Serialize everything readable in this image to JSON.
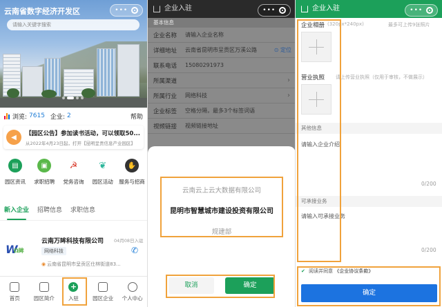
{
  "home": {
    "title": "云南省数字经济开发区",
    "search_placeholder": "请输入关键字搜索",
    "stats": {
      "views_label": "浏览:",
      "views": "7615",
      "companies_label": "企业:",
      "companies": "2",
      "help": "帮助"
    },
    "notice": {
      "title": "【园区公告】参加读书活动，可以领取50...",
      "sub": "从2022年4月23日起，打开【昆明呈贡信息产业园区】"
    },
    "services": [
      {
        "label": "园区资讯",
        "icon": "news-icon",
        "color": "#1ca05a"
      },
      {
        "label": "求职招聘",
        "icon": "briefcase-icon",
        "color": "#5ab84a"
      },
      {
        "label": "党务咨询",
        "icon": "party-emblem-icon",
        "color": "#d93a2b"
      },
      {
        "label": "园区活动",
        "icon": "activity-icon",
        "color": "#2ab59a"
      },
      {
        "label": "服务与招商",
        "icon": "handshake-icon",
        "color": "#333333"
      }
    ],
    "tabs": [
      "新入企业",
      "招聘信息",
      "求职信息"
    ],
    "company": {
      "name": "云南万眸科技有限公司",
      "date": "04月08日入驻",
      "tag": "网络科技",
      "address": "云南省昆明市呈贡区仕林街道83...",
      "logo_text": "万眸科技"
    },
    "tabbar": [
      "首页",
      "园区简介",
      "入驻",
      "园区企业",
      "个人中心"
    ]
  },
  "form": {
    "title": "企业入驻",
    "section": "基本信息",
    "rows": [
      {
        "label": "企业名称",
        "value": "请输入企业名称"
      },
      {
        "label": "详细地址",
        "value": "云南省昆明市呈贡区万溪公路",
        "action": "定位"
      },
      {
        "label": "联系电话",
        "value": "15080291973"
      },
      {
        "label": "所属渠道",
        "value": ""
      },
      {
        "label": "所属行业",
        "value": "网络科技"
      },
      {
        "label": "企业标签",
        "value": "空格分隔，最多3个标签词语"
      },
      {
        "label": "视频链接",
        "value": "视频链接地址"
      }
    ],
    "picker": {
      "options": [
        "云南云上云大数据有限公司",
        "昆明市智慧城市建设投资有限公司",
        "规建部"
      ],
      "cancel": "取消",
      "confirm": "确定"
    }
  },
  "form2": {
    "title": "企业入驻",
    "album_label": "企业相册",
    "album_hint": "(320px*240px)",
    "album_max": "最多可上传9张照片",
    "license_label": "营业执照",
    "license_hint": "请上传营业执照（仅用于审核，不做展示）",
    "other_section": "其他信息",
    "intro_placeholder": "请输入企业介绍",
    "intro_count": "0/200",
    "business_section": "可承接业务",
    "business_placeholder": "请输入可承接业务",
    "business_count": "0/200",
    "agree_prefix": "阅读并同意",
    "agree_link": "《企业协议条款》",
    "confirm": "确定"
  }
}
